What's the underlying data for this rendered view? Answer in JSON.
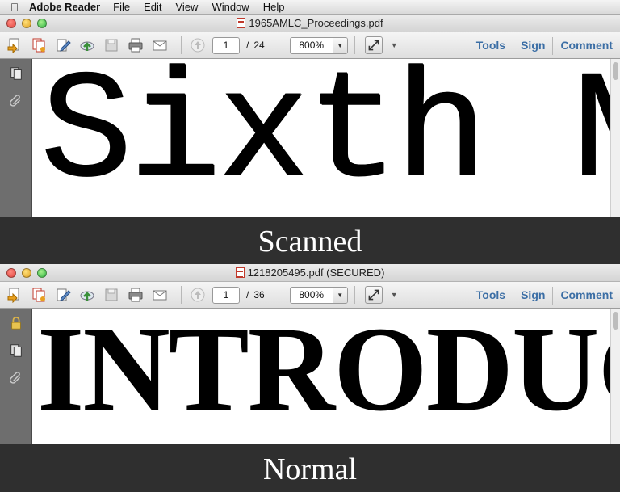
{
  "menubar": {
    "apple_icon": "apple-icon",
    "app_name": "Adobe Reader",
    "items": [
      "File",
      "Edit",
      "View",
      "Window",
      "Help"
    ]
  },
  "windows": [
    {
      "title": "1965AMLC_Proceedings.pdf",
      "page_current": "1",
      "page_total": "24",
      "zoom": "800%",
      "right_tools": [
        "Tools",
        "Sign",
        "Comment"
      ],
      "left_panel_icons": [
        "pages-icon",
        "attachment-icon"
      ],
      "document_text": "Sixth M",
      "caption": "Scanned"
    },
    {
      "title": "1218205495.pdf (SECURED)",
      "page_current": "1",
      "page_total": "36",
      "zoom": "800%",
      "right_tools": [
        "Tools",
        "Sign",
        "Comment"
      ],
      "left_panel_icons": [
        "lock-icon",
        "pages-icon",
        "attachment-icon"
      ],
      "document_text": "INTRODUC",
      "caption": "Normal"
    }
  ],
  "toolbar_icons": [
    "create-pdf-icon",
    "combine-icon",
    "edit-icon",
    "upload-icon",
    "save-icon",
    "print-icon",
    "email-icon",
    "previous-page-icon",
    "fit-expand-icon"
  ],
  "colors": {
    "tool_link": "#3b6ea5",
    "caption_bg": "#2f2f2f",
    "side_panel": "#6e6e6e"
  }
}
